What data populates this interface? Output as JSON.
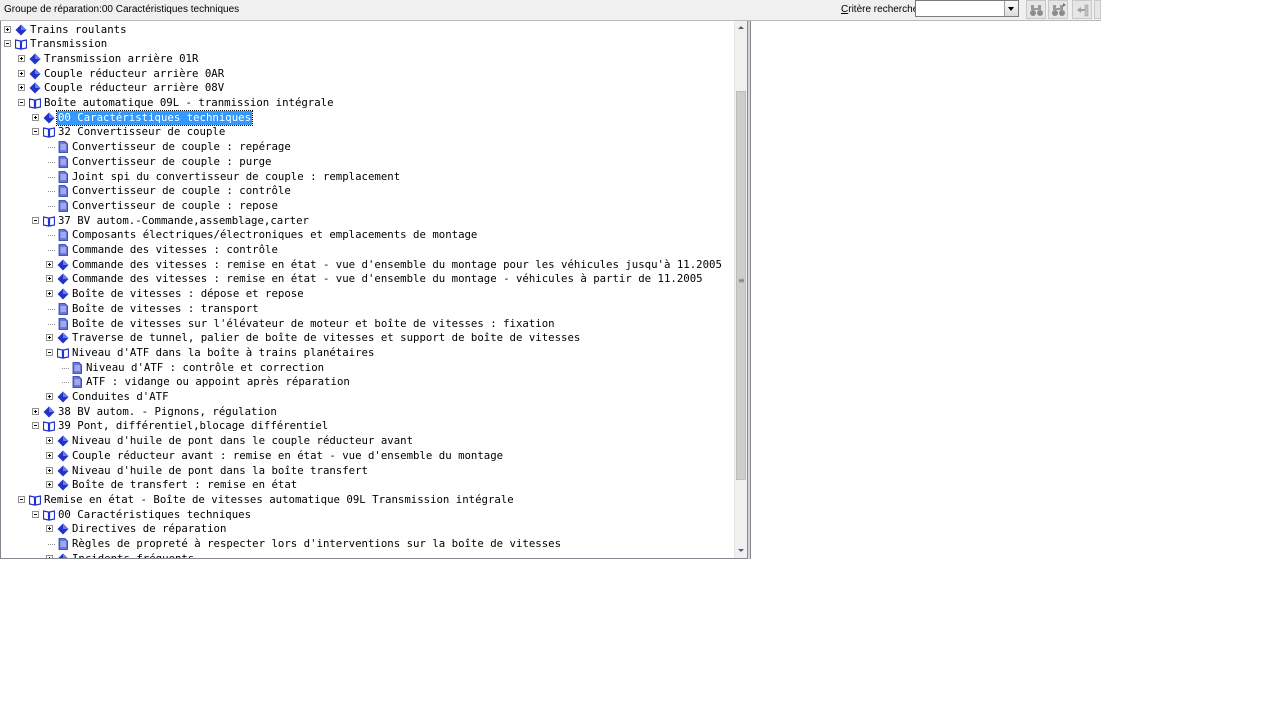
{
  "header": {
    "title": "Groupe de réparation:00 Caractéristiques techniques",
    "search_label_accel": "C",
    "search_label_rest": "ritère recherche:",
    "search_value": ""
  },
  "toolbar": {
    "icons": [
      "binoculars-icon",
      "binoculars-next-icon",
      "navigate-back-icon"
    ]
  },
  "colors": {
    "selection": "#3399ff",
    "book_icon": "#2233cc",
    "toolbar_bg": "#f0f0f0"
  },
  "tree": {
    "nodes": [
      {
        "level": 0,
        "state": "plus",
        "icon": "diamond",
        "label": "Trains roulants"
      },
      {
        "level": 0,
        "state": "minus",
        "icon": "book",
        "label": "Transmission"
      },
      {
        "level": 1,
        "state": "plus",
        "icon": "diamond",
        "label": "Transmission arrière 01R"
      },
      {
        "level": 1,
        "state": "plus",
        "icon": "diamond",
        "label": "Couple réducteur arrière 0AR"
      },
      {
        "level": 1,
        "state": "plus",
        "icon": "diamond",
        "label": "Couple réducteur arrière 08V"
      },
      {
        "level": 1,
        "state": "minus",
        "icon": "book",
        "label": "Boîte automatique 09L - tranmission intégrale"
      },
      {
        "level": 2,
        "state": "plus",
        "icon": "diamond",
        "label": "00 Caractéristiques techniques",
        "selected": true
      },
      {
        "level": 2,
        "state": "minus",
        "icon": "book",
        "label": "32 Convertisseur de couple"
      },
      {
        "level": 3,
        "state": "leaf",
        "icon": "page",
        "label": "Convertisseur de couple : repérage"
      },
      {
        "level": 3,
        "state": "leaf",
        "icon": "page",
        "label": "Convertisseur de couple : purge"
      },
      {
        "level": 3,
        "state": "leaf",
        "icon": "page",
        "label": "Joint spi du convertisseur de couple : remplacement"
      },
      {
        "level": 3,
        "state": "leaf",
        "icon": "page",
        "label": "Convertisseur de couple : contrôle"
      },
      {
        "level": 3,
        "state": "leaf",
        "icon": "page",
        "label": "Convertisseur de couple : repose"
      },
      {
        "level": 2,
        "state": "minus",
        "icon": "book",
        "label": "37 BV autom.-Commande,assemblage,carter"
      },
      {
        "level": 3,
        "state": "leaf",
        "icon": "page",
        "label": "Composants électriques/électroniques et emplacements de montage"
      },
      {
        "level": 3,
        "state": "leaf",
        "icon": "page",
        "label": "Commande des vitesses : contrôle"
      },
      {
        "level": 3,
        "state": "plus",
        "icon": "diamond",
        "label": "Commande des vitesses : remise en état - vue d'ensemble du montage pour les véhicules jusqu'à 11.2005"
      },
      {
        "level": 3,
        "state": "plus",
        "icon": "diamond",
        "label": "Commande des vitesses : remise en état - vue d'ensemble du montage - véhicules à partir de 11.2005"
      },
      {
        "level": 3,
        "state": "plus",
        "icon": "diamond",
        "label": "Boîte de vitesses : dépose et repose"
      },
      {
        "level": 3,
        "state": "leaf",
        "icon": "page",
        "label": "Boîte de vitesses : transport"
      },
      {
        "level": 3,
        "state": "leaf",
        "icon": "page",
        "label": "Boîte de vitesses sur l'élévateur de moteur et boîte de vitesses : fixation"
      },
      {
        "level": 3,
        "state": "plus",
        "icon": "diamond",
        "label": "Traverse de tunnel, palier de boîte de vitesses et support de boîte de vitesses"
      },
      {
        "level": 3,
        "state": "minus",
        "icon": "book",
        "label": "Niveau d'ATF dans la boîte à trains planétaires"
      },
      {
        "level": 4,
        "state": "leaf",
        "icon": "page",
        "label": "Niveau d'ATF : contrôle et correction"
      },
      {
        "level": 4,
        "state": "leaf",
        "icon": "page",
        "label": "ATF : vidange ou appoint après réparation"
      },
      {
        "level": 3,
        "state": "plus",
        "icon": "diamond",
        "label": "Conduites d'ATF"
      },
      {
        "level": 2,
        "state": "plus",
        "icon": "diamond",
        "label": "38 BV autom. - Pignons, régulation"
      },
      {
        "level": 2,
        "state": "minus",
        "icon": "book",
        "label": "39 Pont, différentiel,blocage différentiel"
      },
      {
        "level": 3,
        "state": "plus",
        "icon": "diamond",
        "label": "Niveau d'huile de pont dans le couple réducteur avant"
      },
      {
        "level": 3,
        "state": "plus",
        "icon": "diamond",
        "label": "Couple réducteur avant : remise en état - vue d'ensemble du montage"
      },
      {
        "level": 3,
        "state": "plus",
        "icon": "diamond",
        "label": "Niveau d'huile de pont dans la boîte transfert"
      },
      {
        "level": 3,
        "state": "plus",
        "icon": "diamond",
        "label": "Boîte de transfert : remise en état"
      },
      {
        "level": 1,
        "state": "minus",
        "icon": "book",
        "label": "Remise en état - Boîte de vitesses automatique 09L Transmission intégrale"
      },
      {
        "level": 2,
        "state": "minus",
        "icon": "book",
        "label": "00 Caractéristiques techniques"
      },
      {
        "level": 3,
        "state": "plus",
        "icon": "diamond",
        "label": "Directives de réparation"
      },
      {
        "level": 3,
        "state": "leaf",
        "icon": "page",
        "label": "Règles de propreté à respecter lors d'interventions sur la boîte de vitesses"
      },
      {
        "level": 3,
        "state": "plus",
        "icon": "diamond",
        "label": "Incidents fréquents"
      }
    ]
  }
}
